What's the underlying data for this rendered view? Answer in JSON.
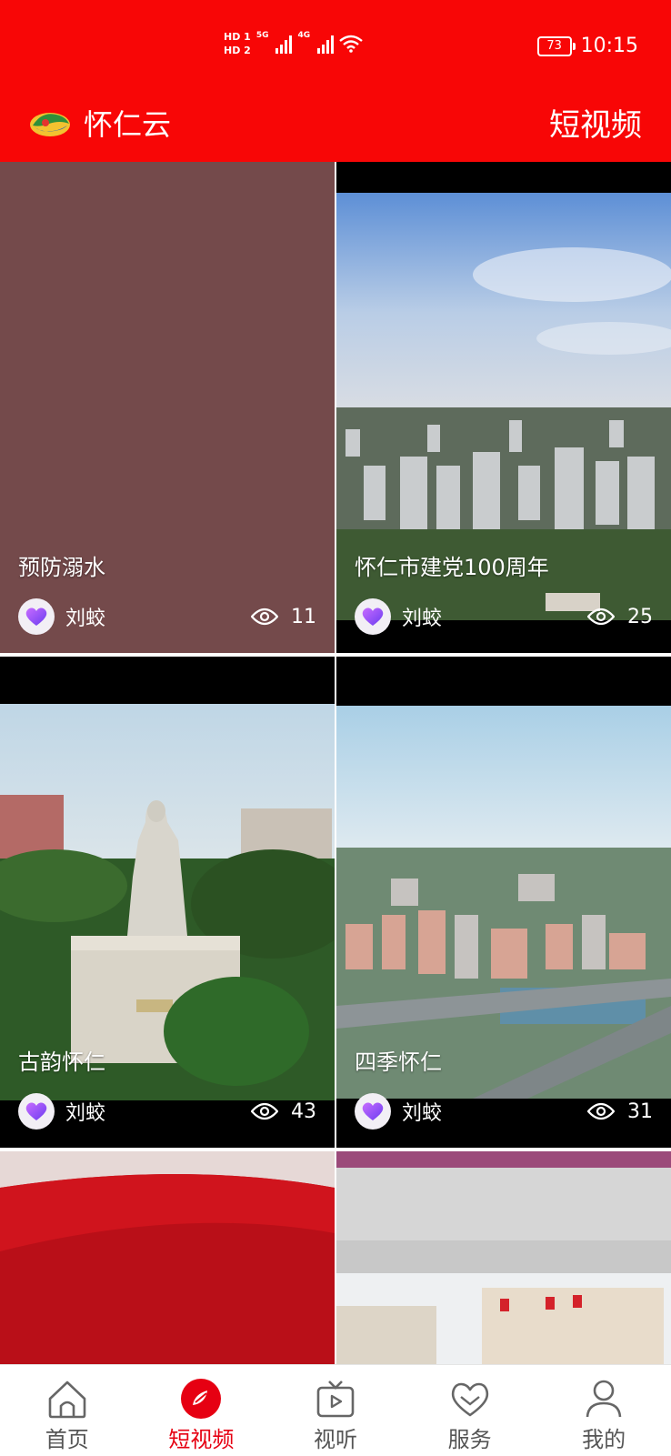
{
  "status_bar": {
    "hd1": "HD 1",
    "hd2": "HD 2",
    "net1": "5G",
    "net2": "4G",
    "battery": "73",
    "time": "10:15"
  },
  "header": {
    "app_name": "怀仁云",
    "section": "短视频"
  },
  "videos": [
    {
      "title": "预防溺水",
      "author": "刘蛟",
      "views": "11"
    },
    {
      "title": "怀仁市建党100周年",
      "author": "刘蛟",
      "views": "25"
    },
    {
      "title": "古韵怀仁",
      "author": "刘蛟",
      "views": "43"
    },
    {
      "title": "四季怀仁",
      "author": "刘蛟",
      "views": "31"
    }
  ],
  "tabs": [
    {
      "label": "首页",
      "icon": "home-icon"
    },
    {
      "label": "短视频",
      "icon": "short-video-icon",
      "active": true
    },
    {
      "label": "视听",
      "icon": "tv-icon"
    },
    {
      "label": "服务",
      "icon": "heart-icon"
    },
    {
      "label": "我的",
      "icon": "user-icon"
    }
  ],
  "colors": {
    "brand_red": "#f80606",
    "active_tab": "#e60012"
  }
}
